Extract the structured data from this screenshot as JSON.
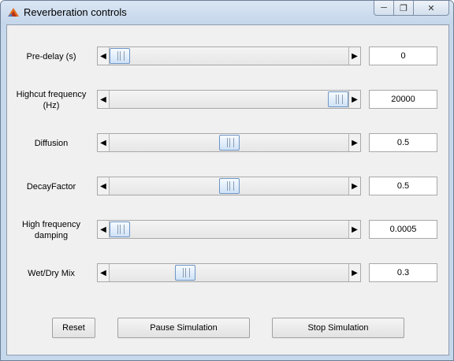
{
  "window": {
    "title": "Reverberation controls",
    "icon": "matlab-icon"
  },
  "controls": [
    {
      "label": "Pre-delay (s)",
      "value": "0",
      "fraction": 0.0
    },
    {
      "label": "Highcut frequency (Hz)",
      "value": "20000",
      "fraction": 1.0
    },
    {
      "label": "Diffusion",
      "value": "0.5",
      "fraction": 0.5
    },
    {
      "label": "DecayFactor",
      "value": "0.5",
      "fraction": 0.5
    },
    {
      "label": "High frequency damping",
      "value": "0.0005",
      "fraction": 0.0
    },
    {
      "label": "Wet/Dry Mix",
      "value": "0.3",
      "fraction": 0.3
    }
  ],
  "buttons": {
    "reset": "Reset",
    "pause": "Pause Simulation",
    "stop": "Stop Simulation"
  }
}
